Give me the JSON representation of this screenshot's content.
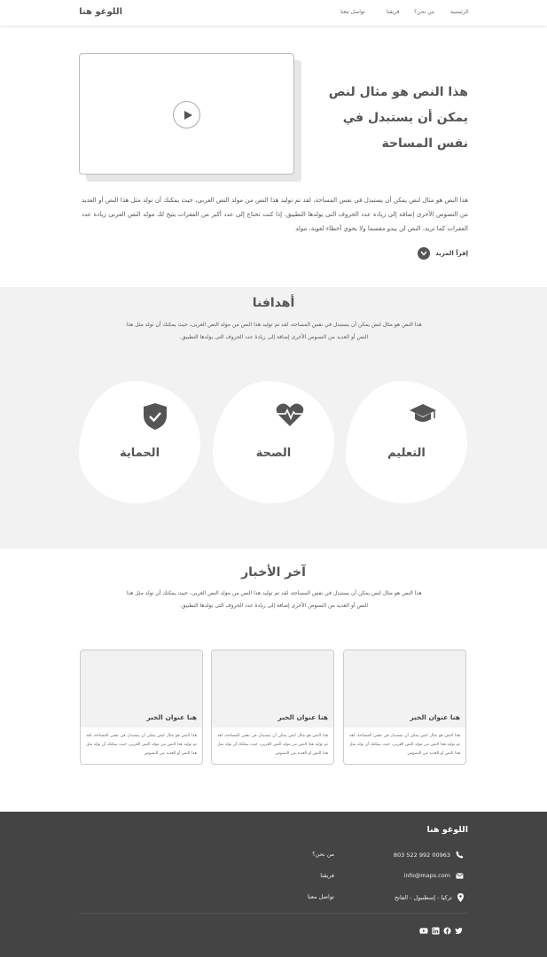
{
  "nav": {
    "logo": "اللوغو هنا",
    "links": [
      "الرئيسية",
      "من نحن؟",
      "فريقنا",
      "تواصل معنا"
    ]
  },
  "hero": {
    "title": "هذا النص هو مثال لنص يمكن أن يستبدل في نفس المساحة",
    "text": "هذا النص هو مثال لنص يمكن أن يستبدل في نفس المساحة، لقد تم توليد هذا النص من مولد النص العربى، حيث يمكنك أن تولد مثل هذا النص أو العديد من النصوص الأخرى إضافة إلى زيادة عدد الحروف التى يولدها التطبيق. إذا كنت تحتاج إلى عدد أكبر من الفقرات يتيح لك مولد النص العربى زيادة عدد الفقرات كما تريد، النص لن يبدو مقسما ولا يحوي أخطاء لغوية، مولد",
    "read_more": "إقرأ المزيد"
  },
  "goals": {
    "title": "أهدافنا",
    "text": "هذا النص هو مثال لنص يمكن أن يستبدل في نفس المساحة، لقد تم توليد هذا النص من مولد النص العربى، حيث يمكنك أن تولد مثل هذا النص أو العديد من النصوص الأخرى إضافة إلى زيادة عدد الحروف التى يولدها التطبيق.",
    "items": [
      {
        "label": "التعليم",
        "icon": "graduation-cap-icon"
      },
      {
        "label": "الصحة",
        "icon": "heartbeat-icon"
      },
      {
        "label": "الحماية",
        "icon": "shield-check-icon"
      }
    ]
  },
  "news": {
    "title": "آخر الأخبار",
    "text": "هذا النص هو مثال لنص يمكن أن يستبدل في نفس المساحة، لقد تم توليد هذا النص من مولد النص العربى، حيث يمكنك أن تولد مثل هذا النص أو العديد من النصوص الأخرى إضافة إلى زيادة عدد الحروف التى يولدها التطبيق.",
    "cards": [
      {
        "title": "هنا عنوان الخبر",
        "text": "هذا النص هو مثال لنص يمكن أن يستبدل في نفس المساحة، لقد تم توليد هذا النص من مولد النص العربى، حيث يمكنك أن تولد مثل هذا النص أو العديد من النصوص"
      },
      {
        "title": "هنا عنوان الخبر",
        "text": "هذا النص هو مثال لنص يمكن أن يستبدل في نفس المساحة، لقد تم توليد هذا النص من مولد النص العربى، حيث يمكنك أن تولد مثل هذا النص أو العديد من النصوص"
      },
      {
        "title": "هنا عنوان الخبر",
        "text": "هذا النص هو مثال لنص يمكن أن يستبدل في نفس المساحة، لقد تم توليد هذا النص من مولد النص العربى، حيث يمكنك أن تولد مثل هذا النص أو العديد من النصوص"
      }
    ]
  },
  "footer": {
    "logo": "اللوغو هنا",
    "phone": "00963 992 522 803",
    "email": "info@maps.com",
    "address": "تركيا - إسطنبول - الفاتح",
    "links": [
      "من نحن؟",
      "فريقنا",
      "تواصل معنا"
    ],
    "social_icons": [
      "twitter-icon",
      "facebook-icon",
      "linkedin-icon",
      "youtube-icon"
    ]
  },
  "colors": {
    "footer_bg": "#444444",
    "section_bg": "#f2f2f2",
    "text": "#555555"
  }
}
